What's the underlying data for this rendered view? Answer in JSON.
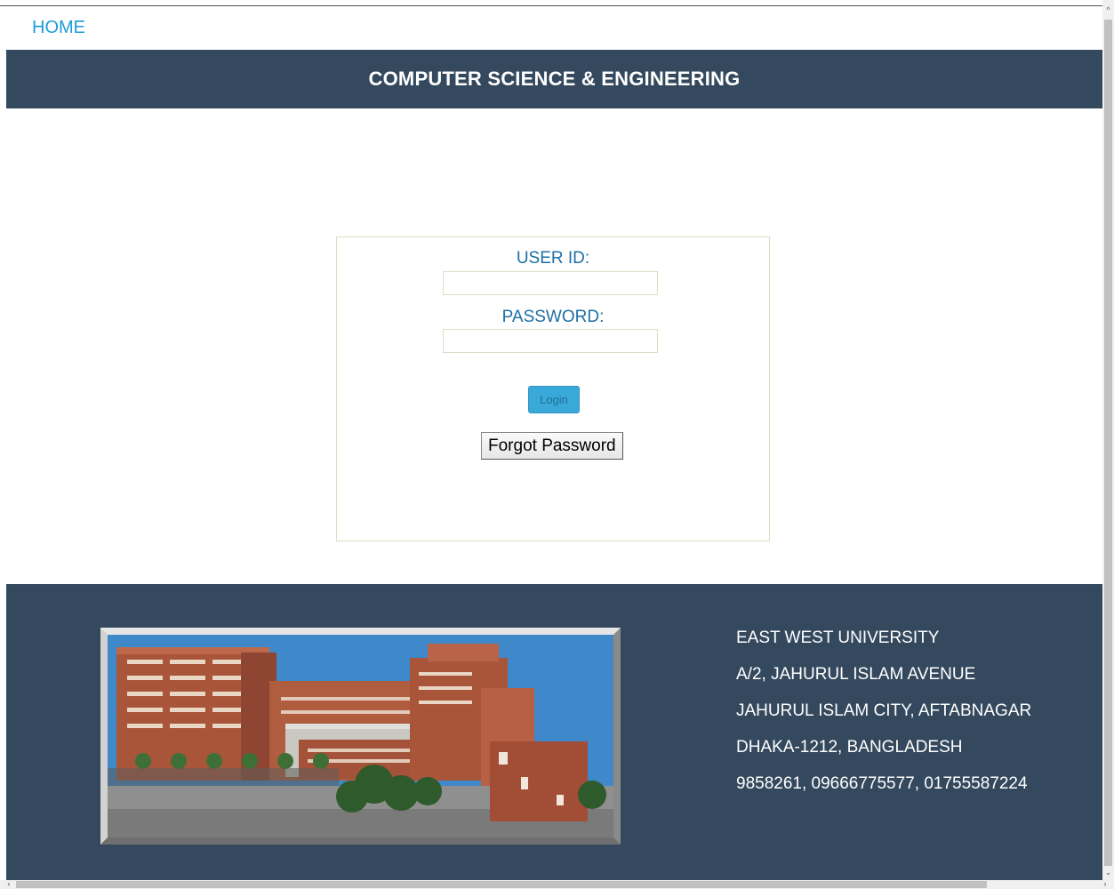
{
  "nav": {
    "home_label": "HOME"
  },
  "header": {
    "title": "COMPUTER SCIENCE & ENGINEERING"
  },
  "login": {
    "user_id_label": "USER ID:",
    "user_id_value": "",
    "password_label": "PASSWORD:",
    "password_value": "",
    "login_button": "Login",
    "forgot_button": "Forgot Password"
  },
  "footer": {
    "image_name": "university-campus-building-image",
    "address": [
      "EAST WEST UNIVERSITY",
      "A/2, JAHURUL ISLAM AVENUE",
      "JAHURUL ISLAM CITY, AFTABNAGAR",
      "DHAKA-1212, BANGLADESH",
      "9858261, 09666775577, 01755587224"
    ]
  },
  "colors": {
    "header_bg": "#34495e",
    "link": "#1e9bd7",
    "label": "#1d6fa3",
    "login_button": "#39a9d9"
  }
}
